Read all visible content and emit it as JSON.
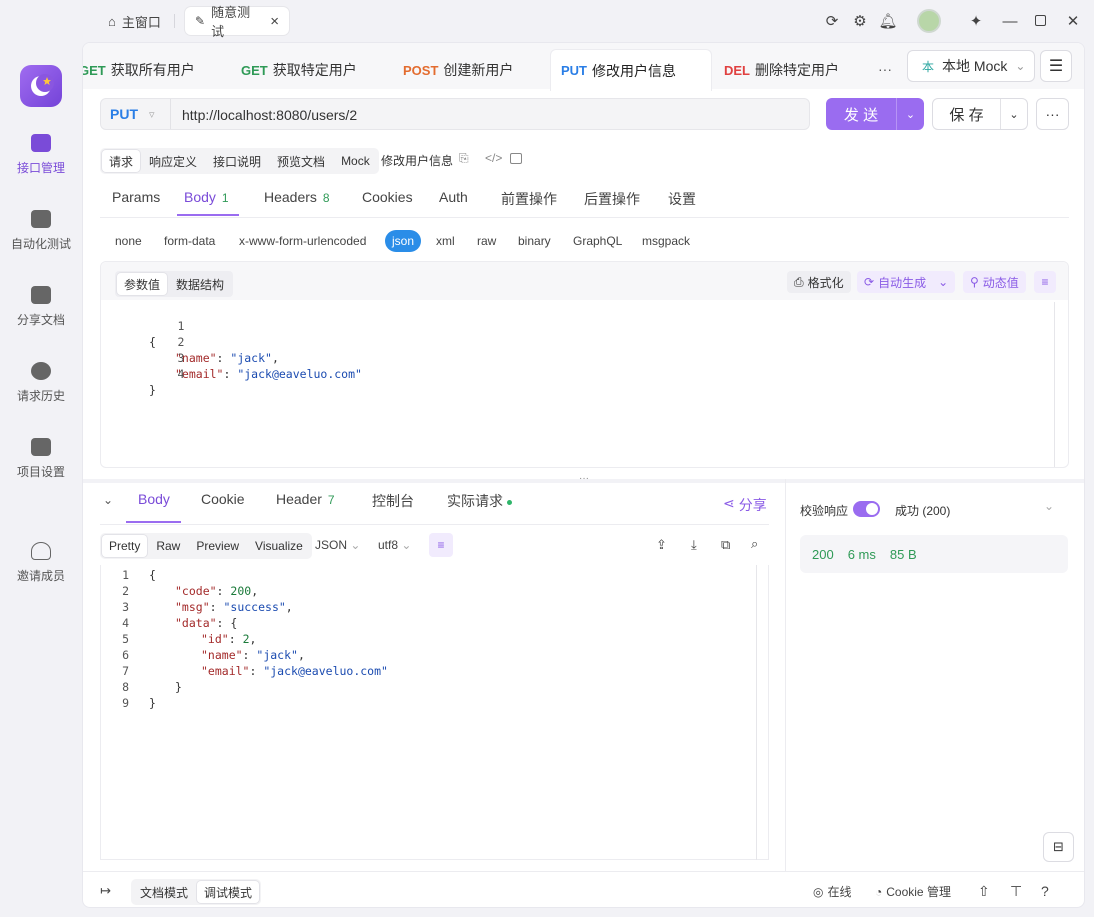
{
  "titlebar": {
    "tabs": [
      {
        "label": "主窗口",
        "icon": "home-icon"
      },
      {
        "label": "随意测试",
        "icon": "edit-icon",
        "close": "×"
      }
    ],
    "icons": [
      "refresh-icon",
      "gear-icon",
      "bell-icon",
      "avatar",
      "pin-icon",
      "minimize-icon",
      "maximize-icon",
      "close-icon"
    ]
  },
  "sidebar": {
    "items": [
      {
        "label": "接口管理",
        "active": true
      },
      {
        "label": "自动化测试"
      },
      {
        "label": "分享文档"
      },
      {
        "label": "请求历史"
      },
      {
        "label": "项目设置"
      },
      {
        "label": "邀请成员"
      }
    ]
  },
  "request_tabs": [
    {
      "method": "GET",
      "name": "获取所有用户"
    },
    {
      "method": "GET",
      "name": "获取特定用户"
    },
    {
      "method": "POST",
      "name": "创建新用户"
    },
    {
      "method": "PUT",
      "name": "修改用户信息",
      "active": true
    },
    {
      "method": "DEL",
      "name": "删除特定用户"
    }
  ],
  "more": "···",
  "env": {
    "badge": "本",
    "label": "本地 Mock",
    "chevron": "⌄"
  },
  "url_bar": {
    "method": "PUT",
    "url": "http://localhost:8080/users/2",
    "send": "发 送",
    "save": "保 存",
    "more": "···"
  },
  "doc_tabs": [
    "请求",
    "响应定义",
    "接口说明",
    "预览文档",
    "Mock"
  ],
  "api_name": "修改用户信息",
  "param_tabs": [
    {
      "label": "Params"
    },
    {
      "label": "Body",
      "count": "1",
      "active": true
    },
    {
      "label": "Headers",
      "count": "8"
    },
    {
      "label": "Cookies"
    },
    {
      "label": "Auth"
    },
    {
      "label": "前置操作"
    },
    {
      "label": "后置操作"
    },
    {
      "label": "设置"
    }
  ],
  "body_types": [
    "none",
    "form-data",
    "x-www-form-urlencoded",
    "json",
    "xml",
    "raw",
    "binary",
    "GraphQL",
    "msgpack"
  ],
  "body_type_active": "json",
  "editor_tabs": [
    "参数值",
    "数据结构"
  ],
  "editor_actions": {
    "format": "格式化",
    "auto": "自动生成",
    "dynamic": "动态值"
  },
  "request_body": [
    {
      "n": "1",
      "text": "{"
    },
    {
      "n": "2",
      "key": "\"name\"",
      "val": "\"jack\"",
      "tail": ","
    },
    {
      "n": "3",
      "key": "\"email\"",
      "val": "\"jack@eaveluo.com\"",
      "tail": ""
    },
    {
      "n": "4",
      "text": "}"
    }
  ],
  "response_tabs": [
    {
      "label": "Body",
      "active": true
    },
    {
      "label": "Cookie"
    },
    {
      "label": "Header",
      "count": "7"
    },
    {
      "label": "控制台"
    },
    {
      "label": "实际请求",
      "dot": true
    }
  ],
  "share": "分享",
  "view_tabs": [
    "Pretty",
    "Raw",
    "Preview",
    "Visualize"
  ],
  "format_select": "JSON",
  "charset_select": "utf8",
  "response_body": [
    {
      "n": "1",
      "indent": 0,
      "text": "{"
    },
    {
      "n": "2",
      "indent": 1,
      "key": "\"code\"",
      "num": "200",
      "tail": ","
    },
    {
      "n": "3",
      "indent": 1,
      "key": "\"msg\"",
      "val": "\"success\"",
      "tail": ","
    },
    {
      "n": "4",
      "indent": 1,
      "key": "\"data\"",
      "text2": "{"
    },
    {
      "n": "5",
      "indent": 2,
      "key": "\"id\"",
      "num": "2",
      "tail": ","
    },
    {
      "n": "6",
      "indent": 2,
      "key": "\"name\"",
      "val": "\"jack\"",
      "tail": ","
    },
    {
      "n": "7",
      "indent": 2,
      "key": "\"email\"",
      "val": "\"jack@eaveluo.com\"",
      "tail": ""
    },
    {
      "n": "8",
      "indent": 1,
      "text": "}"
    },
    {
      "n": "9",
      "indent": 0,
      "text": "}"
    }
  ],
  "validate": {
    "label": "校验响应",
    "result": "成功 (200)"
  },
  "stats": {
    "status": "200",
    "time": "6 ms",
    "size": "85 B"
  },
  "footer": {
    "doc_mode": "文档模式",
    "debug_mode": "调试模式",
    "online": "在线",
    "cookie": "Cookie 管理"
  },
  "colors": {
    "accent": "#9a6cf0",
    "json_active": "#2a8de8",
    "success": "#2f9a57"
  }
}
